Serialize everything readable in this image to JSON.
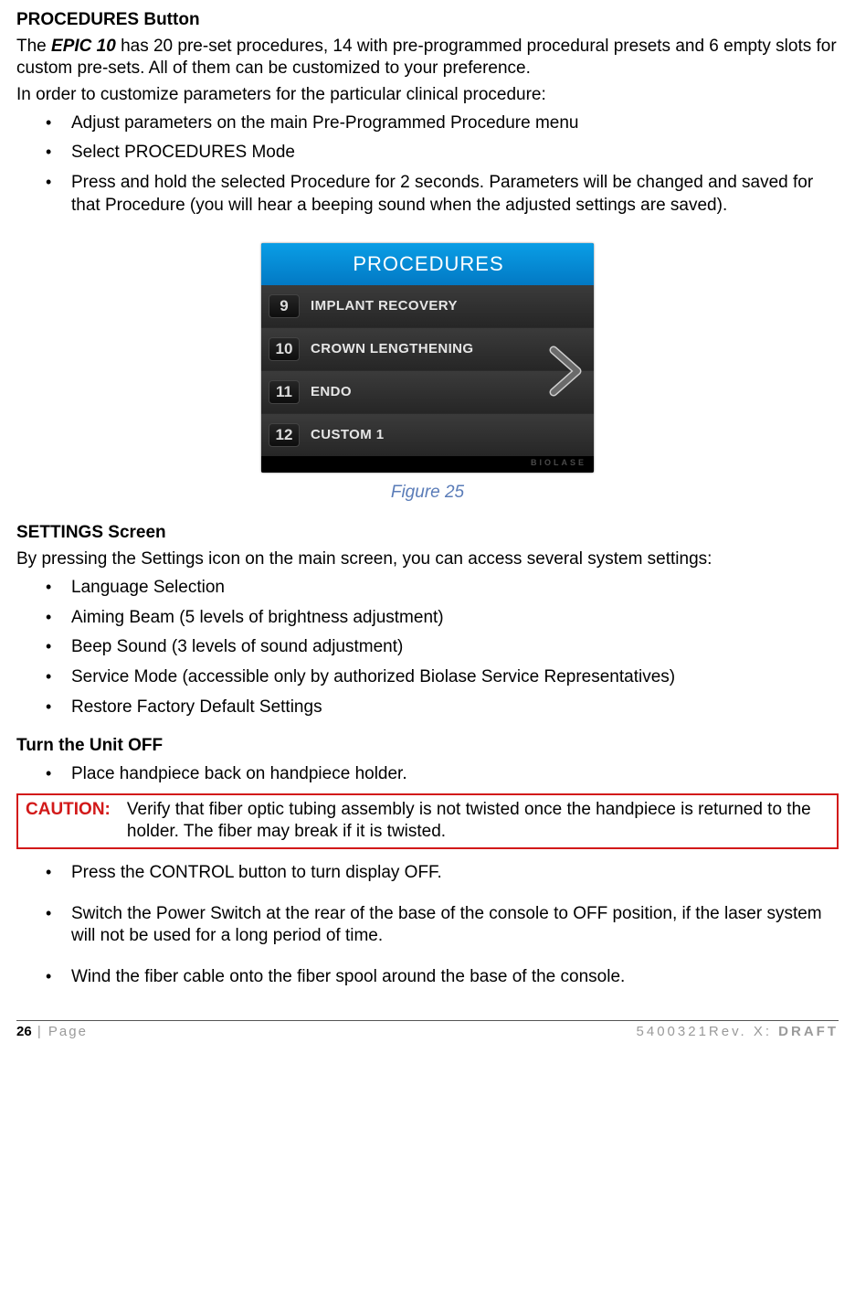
{
  "section1": {
    "heading": "PROCEDURES Button",
    "intro_prefix": "The ",
    "intro_em": "EPIC 10",
    "intro_suffix": " has 20 pre-set procedures, 14 with pre-programmed procedural presets and 6 empty slots for custom pre-sets. All of them can be customized to your preference.",
    "lead": "In order to customize parameters for the particular clinical procedure:",
    "bullets": [
      "Adjust parameters on the main Pre-Programmed Procedure menu",
      "Select PROCEDURES Mode",
      "Press and hold the selected Procedure for 2 seconds. Parameters will be changed and saved for that Procedure (you will hear a beeping sound when the adjusted settings are saved)."
    ]
  },
  "figure25": {
    "caption": "Figure 25",
    "header": "PROCEDURES",
    "footer_brand": "BIOLASE",
    "rows": [
      {
        "num": "9",
        "label": "IMPLANT RECOVERY"
      },
      {
        "num": "10",
        "label": "CROWN LENGTHENING"
      },
      {
        "num": "11",
        "label": "ENDO"
      },
      {
        "num": "12",
        "label": "CUSTOM 1"
      }
    ]
  },
  "section2": {
    "heading": "SETTINGS Screen",
    "intro": "By pressing the Settings icon on the main screen, you can access several system settings:",
    "bullets": [
      "Language Selection",
      "Aiming Beam (5 levels of brightness adjustment)",
      "Beep Sound (3 levels of sound adjustment)",
      "Service Mode (accessible only by authorized Biolase Service Representatives)",
      "Restore Factory Default Settings"
    ]
  },
  "section3": {
    "heading": "Turn the Unit OFF",
    "bullet1": "Place handpiece back on handpiece holder.",
    "caution_label": "CAUTION:",
    "caution_text": "Verify that fiber optic tubing assembly is not twisted once the handpiece is returned to the holder. The fiber may break if it is twisted.",
    "bullets_after": [
      "Press the CONTROL button to turn display OFF.",
      "Switch the Power Switch at the rear of the base of the console to OFF position, if the laser system will not be used for a long period of time.",
      "Wind the fiber cable onto the fiber spool around the base of the console."
    ]
  },
  "footer": {
    "page_num": "26",
    "page_label": " | Page",
    "doc_ref": "5400321Rev. X: ",
    "draft": "DRAFT"
  }
}
